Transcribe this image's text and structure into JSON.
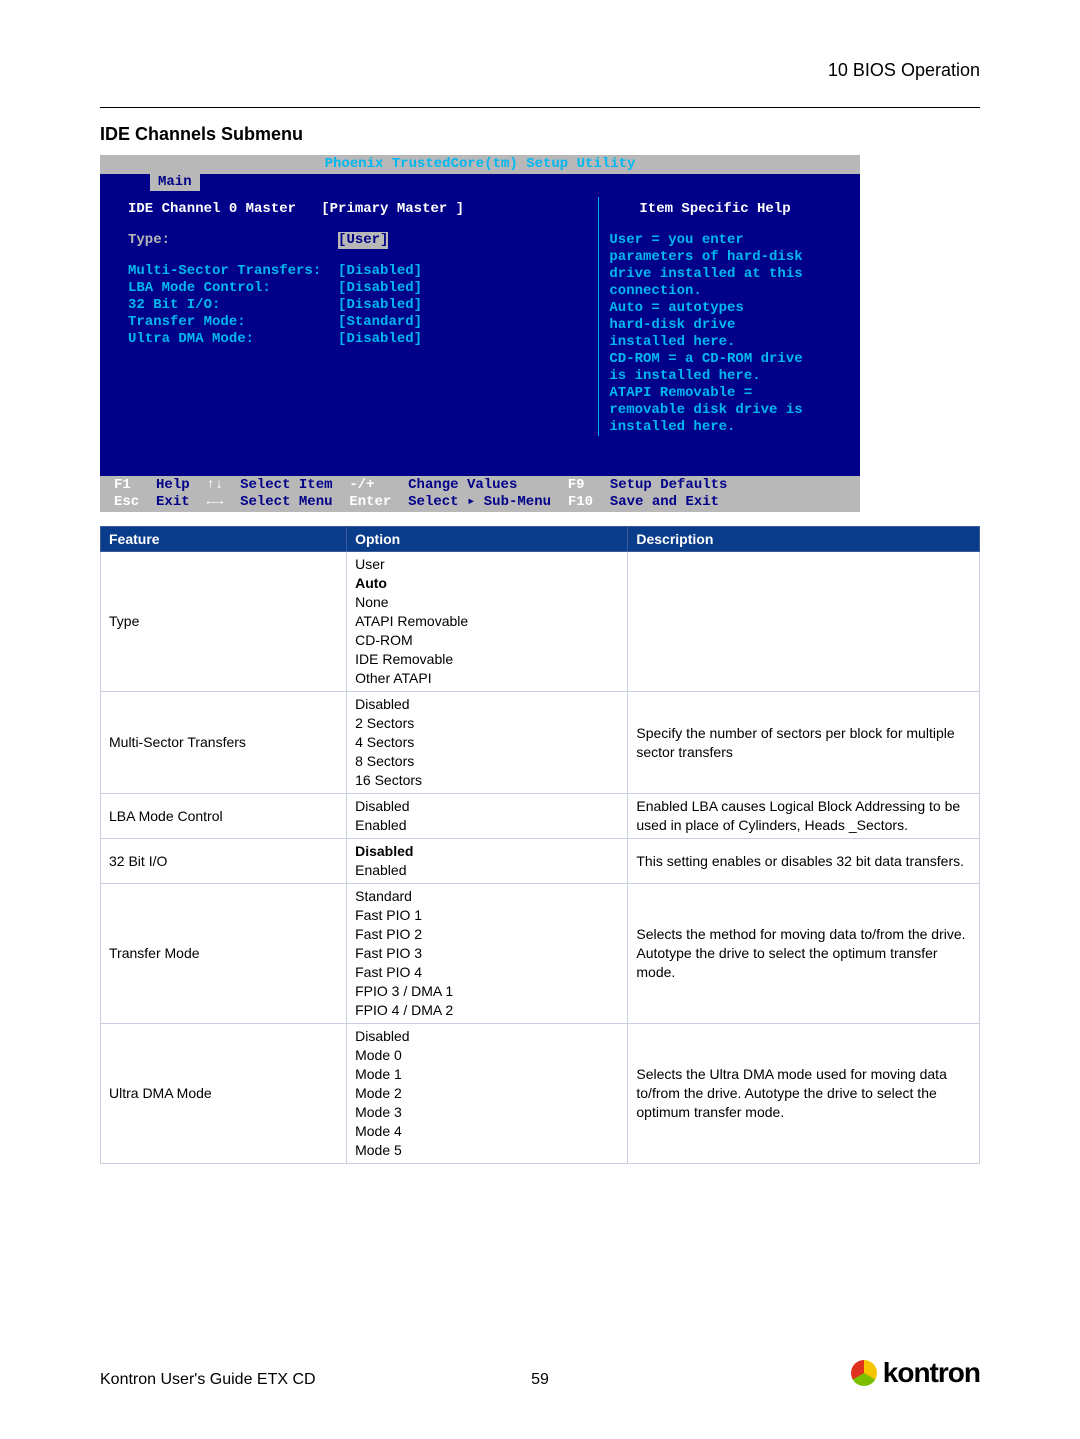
{
  "header": {
    "section": "10 BIOS Operation"
  },
  "title": "IDE Channels Submenu",
  "bios": {
    "utility_title": "Phoenix TrustedCore(tm) Setup Utility",
    "active_tab": "Main",
    "panel_title_left": "IDE Channel 0 Master",
    "panel_title_value": "[Primary Master ]",
    "panel_title_right": "Item Specific Help",
    "fields": [
      {
        "label": "Type:",
        "value": "[User]",
        "selected": true
      },
      {
        "label": "Multi-Sector Transfers:",
        "value": "[Disabled]"
      },
      {
        "label": "LBA Mode Control:",
        "value": "[Disabled]"
      },
      {
        "label": "32 Bit I/O:",
        "value": "[Disabled]"
      },
      {
        "label": "Transfer Mode:",
        "value": "[Standard]"
      },
      {
        "label": "Ultra DMA Mode:",
        "value": "[Disabled]"
      }
    ],
    "help_lines": [
      "User = you enter",
      "parameters of hard-disk",
      "drive installed at this",
      "connection.",
      "Auto = autotypes",
      "hard-disk drive",
      "installed here.",
      "CD-ROM = a CD-ROM drive",
      "is installed here.",
      "ATAPI Removable =",
      "removable disk drive is",
      "installed here."
    ],
    "footer": {
      "f1": "F1",
      "help": "Help",
      "ud": "↑↓",
      "si": "Select Item",
      "pm": "-/+",
      "cv": "Change Values",
      "f9": "F9",
      "sd": "Setup Defaults",
      "esc": "Esc",
      "exit": "Exit",
      "lr": "←→",
      "sm": "Select Menu",
      "enter": "Enter",
      "ssm": "Select ▸ Sub-Menu",
      "f10": "F10",
      "se": "Save and Exit"
    }
  },
  "table": {
    "headers": [
      "Feature",
      "Option",
      "Description"
    ],
    "rows": [
      {
        "feature": "Type",
        "options": [
          "User",
          "Auto",
          "None",
          "ATAPI Removable",
          "CD-ROM",
          "IDE Removable",
          "Other ATAPI"
        ],
        "bold_index": 1,
        "description": ""
      },
      {
        "feature": "Multi-Sector Transfers",
        "options": [
          "Disabled",
          "2 Sectors",
          "4 Sectors",
          "8 Sectors",
          "16 Sectors"
        ],
        "bold_index": -1,
        "description": "Specify the number of sectors per block for multiple sector transfers"
      },
      {
        "feature": "LBA Mode Control",
        "options": [
          "Disabled",
          "Enabled"
        ],
        "bold_index": -1,
        "description": "Enabled LBA causes Logical Block Addressing to be used in place of Cylinders, Heads _Sectors."
      },
      {
        "feature": "32 Bit I/O",
        "options": [
          "Disabled",
          "Enabled"
        ],
        "bold_index": 0,
        "description": "This setting enables or disables 32 bit data transfers."
      },
      {
        "feature": "Transfer Mode",
        "options": [
          "Standard",
          "Fast PIO 1",
          "Fast PIO 2",
          "Fast PIO 3",
          "Fast PIO 4",
          "FPIO 3 / DMA 1",
          "FPIO 4 / DMA 2"
        ],
        "bold_index": -1,
        "description": "Selects the method for moving data to/from the drive. Autotype the drive to select the optimum transfer mode."
      },
      {
        "feature": "Ultra DMA Mode",
        "options": [
          "Disabled",
          "Mode  0",
          "Mode 1",
          "Mode 2",
          "Mode 3",
          "Mode 4",
          "Mode 5"
        ],
        "bold_index": -1,
        "description": "Selects the Ultra DMA mode used for moving data to/from the drive. Autotype the drive to select the optimum transfer mode."
      }
    ]
  },
  "footer": {
    "left": "Kontron User's Guide ETX CD",
    "page": "59",
    "brand": "kontron"
  }
}
